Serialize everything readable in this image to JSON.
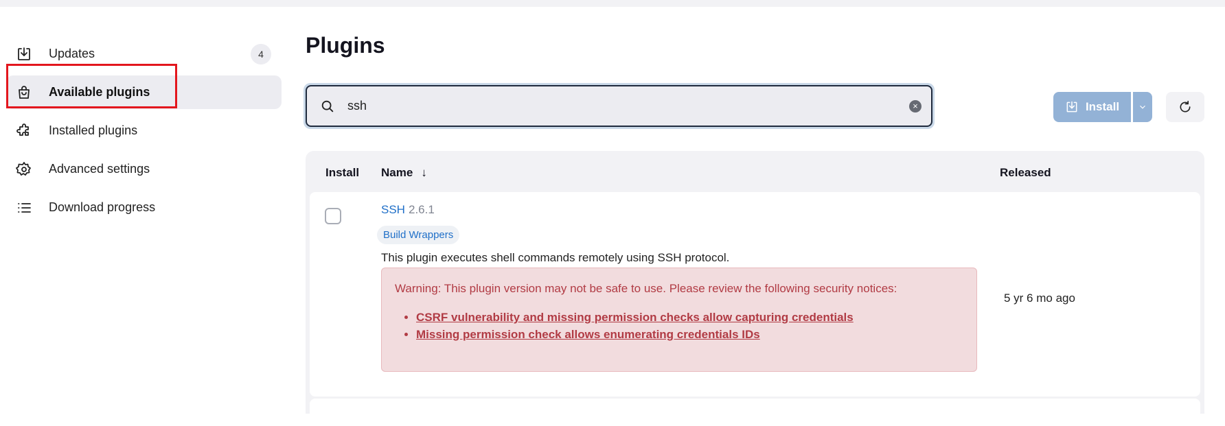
{
  "sidebar": {
    "items": [
      {
        "label": "Updates",
        "icon": "download-icon",
        "badge": "4",
        "active": false
      },
      {
        "label": "Available plugins",
        "icon": "shopping-bag-icon",
        "active": true
      },
      {
        "label": "Installed plugins",
        "icon": "puzzle-icon",
        "active": false
      },
      {
        "label": "Advanced settings",
        "icon": "gear-icon",
        "active": false
      },
      {
        "label": "Download progress",
        "icon": "list-icon",
        "active": false
      }
    ]
  },
  "main": {
    "title": "Plugins",
    "search": {
      "value": "ssh",
      "placeholder": ""
    },
    "install_label": "Install"
  },
  "table": {
    "headers": {
      "install": "Install",
      "name": "Name",
      "name_sort": "↓",
      "released": "Released"
    },
    "rows": [
      {
        "name": "SSH",
        "version": "2.6.1",
        "tag": "Build Wrappers",
        "description": "This plugin executes shell commands remotely using SSH protocol.",
        "warning": "Warning: This plugin version may not be safe to use. Please review the following security notices:",
        "security_links": [
          "CSRF vulnerability and missing permission checks allow capturing credentials",
          "Missing permission check allows enumerating credentials IDs"
        ],
        "released": "5 yr 6 mo ago"
      }
    ]
  },
  "colors": {
    "accent": "#1f6fc8",
    "warning_bg": "#f2dcde",
    "warning_text": "#b13b44",
    "highlight": "#e3161d"
  }
}
